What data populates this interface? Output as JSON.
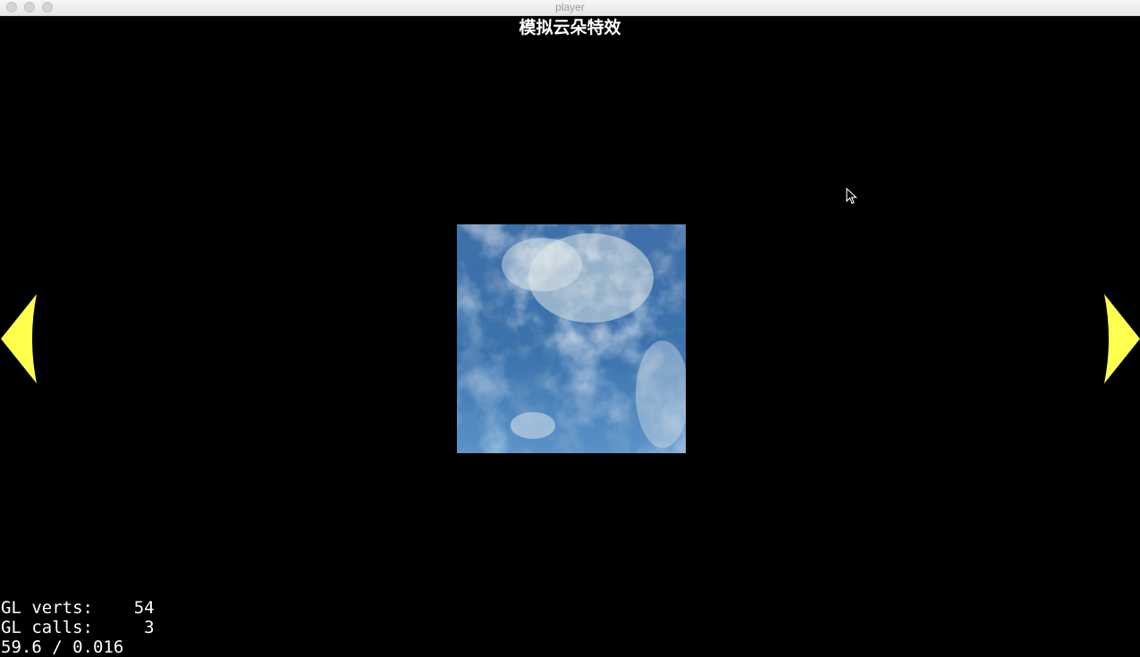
{
  "window": {
    "title": "player"
  },
  "scene": {
    "title": "模拟云朵特效"
  },
  "navigation": {
    "prev_icon": "triangle-left-icon",
    "next_icon": "triangle-right-icon",
    "arrow_color": "#ffff4d"
  },
  "stats": {
    "verts_line": "GL verts:    54",
    "calls_line": "GL calls:     3",
    "fps_line": "59.6 / 0.016"
  },
  "colors": {
    "background": "#000000",
    "sky_blue": "#4f86bf",
    "cloud_white": "#e8eeee"
  }
}
